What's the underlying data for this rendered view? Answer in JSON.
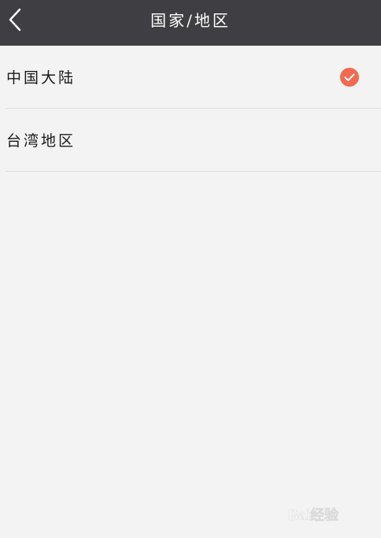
{
  "header": {
    "title": "国家/地区",
    "back_icon": "chevron-left-icon"
  },
  "regions": {
    "items": [
      {
        "label": "中国大陆",
        "selected": true
      },
      {
        "label": "台湾地区",
        "selected": false
      }
    ]
  },
  "colors": {
    "header_bg": "#3f3f43",
    "accent": "#f26a4f",
    "page_bg": "#f3f3f3",
    "divider": "#dddddd"
  },
  "watermark": {
    "text": "Bai经验"
  }
}
